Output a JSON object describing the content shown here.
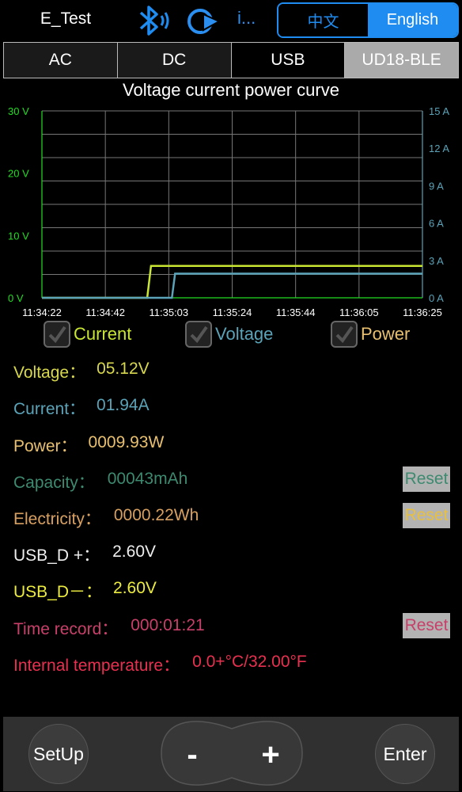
{
  "header": {
    "app_name": "E_Test",
    "more_label": "i...",
    "lang_zh": "中文",
    "lang_en": "English"
  },
  "tabs": [
    "AC",
    "DC",
    "USB",
    "UD18-BLE"
  ],
  "chart_data": {
    "type": "line",
    "title": "Voltage current power curve",
    "x": [
      "11:34:22",
      "11:34:42",
      "11:35:03",
      "11:35:24",
      "11:35:44",
      "11:36:05",
      "11:36:25"
    ],
    "left_axis": {
      "ticks": [
        "0 V",
        "10 V",
        "20 V",
        "30 V"
      ],
      "range": [
        0,
        30
      ],
      "color": "#22dd22"
    },
    "right_axis": {
      "ticks": [
        "0 A",
        "3 A",
        "6 A",
        "9 A",
        "12 A",
        "15 A"
      ],
      "range": [
        0,
        15
      ],
      "color": "#5aa3b8"
    },
    "series": [
      {
        "name": "Voltage",
        "color": "#c8e632",
        "axis": "left",
        "points": [
          [
            0,
            0
          ],
          [
            1.66,
            0
          ],
          [
            1.72,
            5.12
          ],
          [
            6,
            5.12
          ]
        ]
      },
      {
        "name": "Current",
        "color": "#5aa3b8",
        "axis": "right",
        "points": [
          [
            0,
            0
          ],
          [
            2.05,
            0
          ],
          [
            2.1,
            1.94
          ],
          [
            6,
            1.94
          ]
        ]
      }
    ],
    "grid": true
  },
  "toggles": {
    "current": "Current",
    "voltage": "Voltage",
    "power": "Power"
  },
  "readings": {
    "voltage_label": "Voltage：",
    "voltage_value": "05.12V",
    "current_label": "Current：",
    "current_value": "01.94A",
    "power_label": "Power：",
    "power_value": "0009.93W",
    "capacity_label": "Capacity：",
    "capacity_value": "00043mAh",
    "electricity_label": "Electricity：",
    "electricity_value": "0000.22Wh",
    "usbdp_label": "USB_D +：",
    "usbdp_value": "2.60V",
    "usbdm_label": "USB_D－：",
    "usbdm_value": "2.60V",
    "time_label": "Time record：",
    "time_value": "000:01:21",
    "temp_label": "Internal temperature：",
    "temp_value": "0.0+°C/32.00°F",
    "reset_label": "Reset"
  },
  "bottom": {
    "setup": "SetUp",
    "minus": "-",
    "plus": "+",
    "enter": "Enter"
  },
  "colors": {
    "accent": "#1e8cf0",
    "voltage": "#d8d84e",
    "current": "#5aa3b8",
    "power": "#e8c070",
    "capacity": "#3d8a70",
    "electricity": "#d8a060",
    "usbdm": "#ecec40",
    "time": "#c8406a",
    "temp": "#e83050"
  }
}
